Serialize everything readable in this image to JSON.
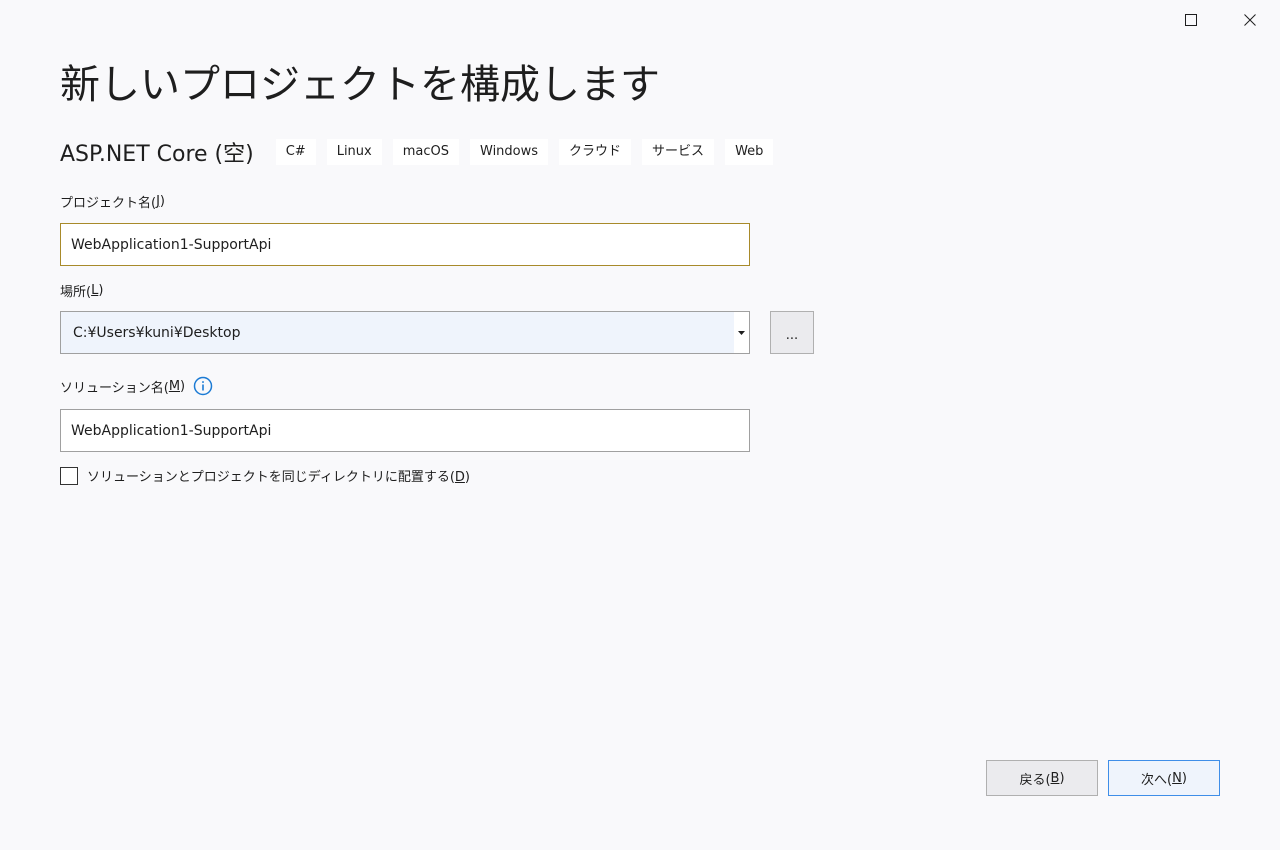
{
  "window": {
    "maximize_icon": "maximize-icon",
    "close_icon": "close-icon"
  },
  "page": {
    "title": "新しいプロジェクトを構成します"
  },
  "template": {
    "name": "ASP.NET Core (空)",
    "tags": [
      "C#",
      "Linux",
      "macOS",
      "Windows",
      "クラウド",
      "サービス",
      "Web"
    ]
  },
  "project_name": {
    "label_text": "プロジェクト名(",
    "label_accel": "J",
    "label_end": ")",
    "value": "WebApplication1-SupportApi"
  },
  "location": {
    "label_text": "場所(",
    "label_accel": "L",
    "label_end": ")",
    "value": "C:¥Users¥kuni¥Desktop",
    "browse_label": "..."
  },
  "solution_name": {
    "label_text": "ソリューション名(",
    "label_accel": "M",
    "label_end": ")",
    "value": "WebApplication1-SupportApi",
    "info_icon": "info-icon"
  },
  "same_dir_checkbox": {
    "checked": false,
    "label_text": "ソリューションとプロジェクトを同じディレクトリに配置する(",
    "label_accel": "D",
    "label_end": ")"
  },
  "footer": {
    "back_text": "戻る(",
    "back_accel": "B",
    "back_end": ")",
    "next_text": "次へ(",
    "next_accel": "N",
    "next_end": ")"
  },
  "colors": {
    "background": "#f9f9fb",
    "focus_border": "#a88a2a",
    "primary_border": "#3f8ee8",
    "info_blue": "#1c7bd4"
  }
}
